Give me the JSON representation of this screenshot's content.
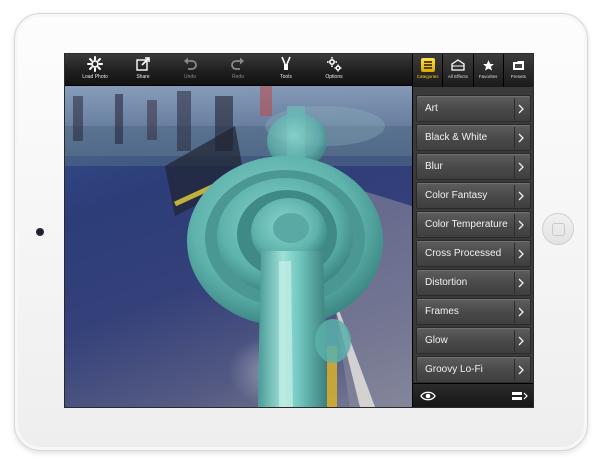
{
  "toolbar": {
    "load_photo": "Load Photo",
    "share": "Share",
    "undo": "Undo",
    "redo": "Redo",
    "tools": "Tools",
    "options": "Options"
  },
  "tabs": [
    {
      "label": "Categories",
      "icon": "categories-icon",
      "active": true
    },
    {
      "label": "All Effects",
      "icon": "all-effects-icon",
      "active": false
    },
    {
      "label": "Favorites",
      "icon": "star-icon",
      "active": false
    },
    {
      "label": "Presets",
      "icon": "presets-icon",
      "active": false
    }
  ],
  "categories": [
    "Art",
    "Black & White",
    "Blur",
    "Color Fantasy",
    "Color Temperature",
    "Cross Processed",
    "Distortion",
    "Frames",
    "Glow",
    "Groovy Lo-Fi"
  ],
  "colors": {
    "accent": "#ffd21f",
    "railing": "#6ec3bd",
    "sidebar": "#4a4a4a"
  }
}
